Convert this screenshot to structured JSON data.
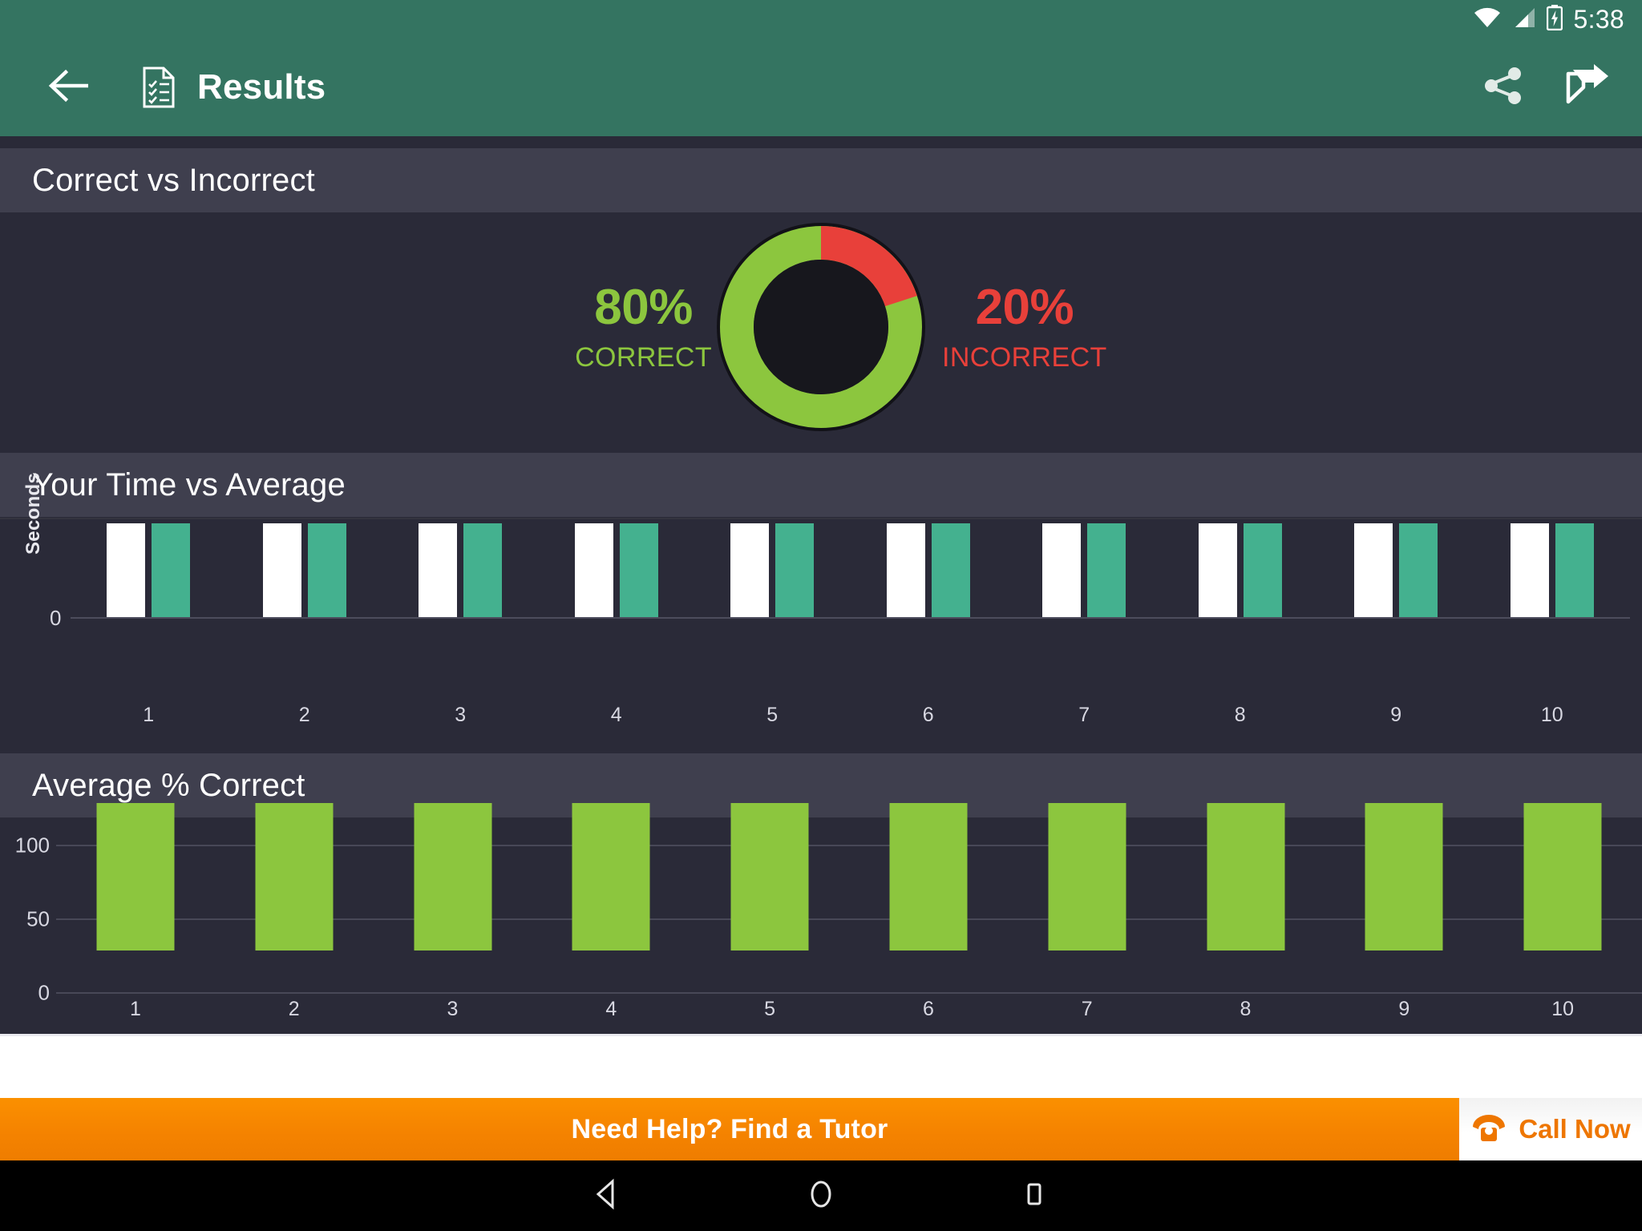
{
  "status_bar": {
    "time": "5:38",
    "icons": [
      "wifi-icon",
      "cell-signal-icon",
      "battery-charging-icon"
    ]
  },
  "app_bar": {
    "back_icon": "back-arrow-icon",
    "doc_icon": "results-document-icon",
    "title": "Results",
    "actions": [
      {
        "icon": "share-icon",
        "label": "Share"
      },
      {
        "icon": "send-flag-icon",
        "label": "Send"
      }
    ]
  },
  "sections": {
    "correct_vs_incorrect": {
      "title": "Correct vs Incorrect"
    },
    "time_vs_average": {
      "title": "Your Time vs Average"
    },
    "average_percent_correct": {
      "title": "Average % Correct"
    }
  },
  "donut": {
    "correct_value": "80%",
    "correct_label": "CORRECT",
    "incorrect_value": "20%",
    "incorrect_label": "INCORRECT"
  },
  "banner": {
    "text": "Need Help? Find a Tutor",
    "call_label": "Call Now",
    "call_icon": "telephone-icon"
  },
  "nav_bar": {
    "back": "nav-back-triangle-icon",
    "home": "nav-home-circle-icon",
    "recents": "nav-recents-square-icon"
  },
  "colors": {
    "accent_green": "#347461",
    "correct_green": "#8cc63e",
    "incorrect_red": "#e8403a",
    "avg_teal": "#44b18f",
    "your_time_white": "#ffffff",
    "panel_bg": "#2a2a38",
    "section_header_bg": "#3f3f4e",
    "banner_orange": "#f58300",
    "call_text_orange": "#ee7600"
  },
  "chart_data": [
    {
      "type": "pie",
      "title": "Correct vs Incorrect",
      "labels": [
        "CORRECT",
        "INCORRECT"
      ],
      "values": [
        80,
        20
      ],
      "colors": [
        "#8cc63e",
        "#e8403a"
      ],
      "units": "%",
      "donut": true,
      "legend": "sides"
    },
    {
      "type": "bar",
      "title": "Your Time vs Average",
      "categories": [
        "1",
        "2",
        "3",
        "4",
        "5",
        "6",
        "7",
        "8",
        "9",
        "10"
      ],
      "series": [
        {
          "name": "Your Time",
          "color": "#ffffff",
          "values": [
            1,
            1,
            1,
            1,
            1,
            1,
            1,
            1,
            1,
            1
          ]
        },
        {
          "name": "Average",
          "color": "#44b18f",
          "values": [
            1,
            1,
            1,
            1,
            1,
            1,
            1,
            1,
            1,
            1
          ]
        }
      ],
      "xlabel": "",
      "ylabel": "Seconds",
      "yticks": [
        "0"
      ],
      "ylim": [
        0,
        1
      ],
      "grid": true,
      "legend": "none"
    },
    {
      "type": "bar",
      "title": "Average % Correct",
      "categories": [
        "1",
        "2",
        "3",
        "4",
        "5",
        "6",
        "7",
        "8",
        "9",
        "10"
      ],
      "values": [
        100,
        100,
        100,
        100,
        100,
        100,
        100,
        100,
        100,
        100
      ],
      "color": "#8cc63e",
      "xlabel": "",
      "ylabel": "",
      "yticks": [
        "100",
        "50",
        "0"
      ],
      "ylim": [
        0,
        100
      ],
      "grid": true,
      "legend": "none"
    }
  ]
}
